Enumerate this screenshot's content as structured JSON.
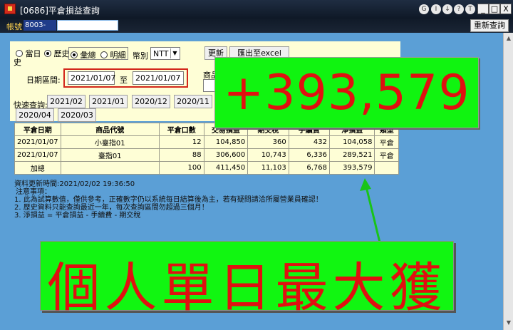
{
  "window": {
    "title": "[0686]平倉損益查詢",
    "buttons": {
      "minimize": "_",
      "maximize": "□",
      "close": "X"
    },
    "tool_icons": [
      "G",
      "I",
      "↓",
      "?",
      "T"
    ]
  },
  "account": {
    "label": "帳號",
    "value": "8003-0066",
    "refresh_label": "重新查詢"
  },
  "query": {
    "period_options": {
      "today": "當日",
      "history": "歷史",
      "history_second_line": "史"
    },
    "mode_options": {
      "summary": "彙總",
      "detail": "明細"
    },
    "currency_label": "幣別",
    "currency_value": "NTT",
    "update_button": "更新",
    "export_button": "匯出至excel",
    "product_label": "商品",
    "date_range_label": "日期區間:",
    "date_from": "2021/01/07",
    "date_to_label": "至",
    "date_to": "2021/01/07",
    "quick_label": "快速查詢:",
    "quick_buttons": [
      "2021/02",
      "2021/01",
      "2020/12",
      "2020/11",
      "2020/04",
      "2020/03"
    ]
  },
  "table": {
    "headers": [
      "平倉日期",
      "商品代號",
      "平倉口數",
      "交易損益",
      "期交稅",
      "手續費",
      "淨損益",
      "類型"
    ],
    "rows": [
      [
        "2021/01/07",
        "小臺指01",
        "12",
        "104,850",
        "360",
        "432",
        "104,058",
        "平倉"
      ],
      [
        "2021/01/07",
        "臺指01",
        "88",
        "306,600",
        "10,743",
        "6,336",
        "289,521",
        "平倉"
      ]
    ],
    "total": [
      "加總",
      "",
      "100",
      "411,450",
      "11,103",
      "6,768",
      "393,579",
      ""
    ]
  },
  "notes": {
    "update_time": "資料更新時間:2021/02/02 19:36:50",
    "title": "注意事項：",
    "lines": [
      "1. 此為試算數值，僅供參考，正確數字仍以系統每日結算後為主，若有疑問請洽所屬營業員確認！",
      "2. 歷史資料只能查詢最近一年，每次查詢區間勿超過三個月！",
      "3. 淨損益 = 平倉損益 - 手續費 - 期交稅"
    ]
  },
  "overlay": {
    "amount": "+393,579",
    "banner": "個人單日最大獲"
  },
  "colors": {
    "highlight": "#10f410",
    "accent_red": "#e01010",
    "arrow": "#19c419",
    "frame": "#d3261a"
  }
}
